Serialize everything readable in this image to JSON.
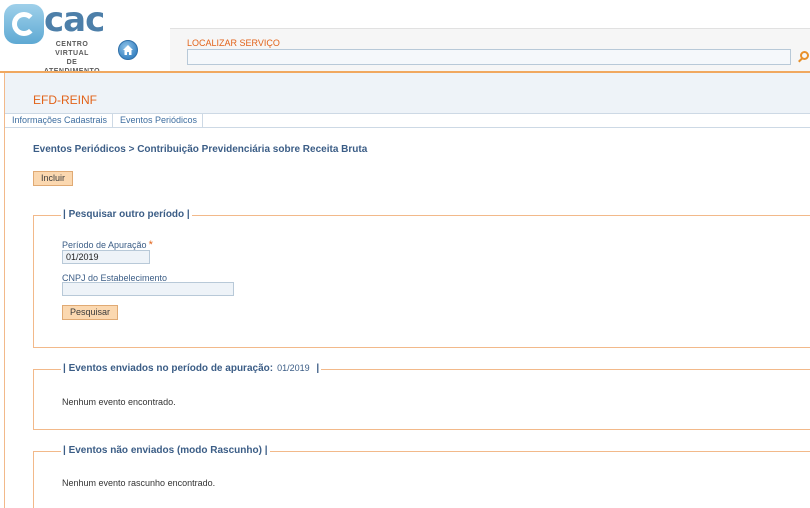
{
  "header": {
    "logo_text": "cac",
    "logo_sub_line1": "CENTRO VIRTUAL",
    "logo_sub_line2": "DE ATENDIMENTO",
    "search_label": "LOCALIZAR SERVIÇO",
    "search_value": ""
  },
  "app": {
    "title": "EFD-REINF",
    "tabs": [
      {
        "label": "Informações Cadastrais"
      },
      {
        "label": "Eventos Periódicos"
      }
    ],
    "breadcrumb": "Eventos Periódicos > Contribuição Previdenciária sobre Receita Bruta",
    "include_button": "Incluir"
  },
  "search_form": {
    "legend": "| Pesquisar outro período |",
    "period_label": "Período de Apuração",
    "period_required_mark": "*",
    "period_value": "01/2019",
    "cnpj_label": "CNPJ do Estabelecimento",
    "cnpj_value": "",
    "search_button": "Pesquisar"
  },
  "sent_events": {
    "legend": "| Eventos enviados no período de apuração:",
    "period": "01/2019",
    "legend_end": "|",
    "message": "Nenhum evento encontrado."
  },
  "draft_events": {
    "legend": "| Eventos não enviados (modo Rascunho) |",
    "message": "Nenhum evento rascunho encontrado."
  },
  "colors": {
    "accent_orange": "#e2631a",
    "link_blue": "#3b5d86",
    "button_bg": "#fbd8b0"
  }
}
